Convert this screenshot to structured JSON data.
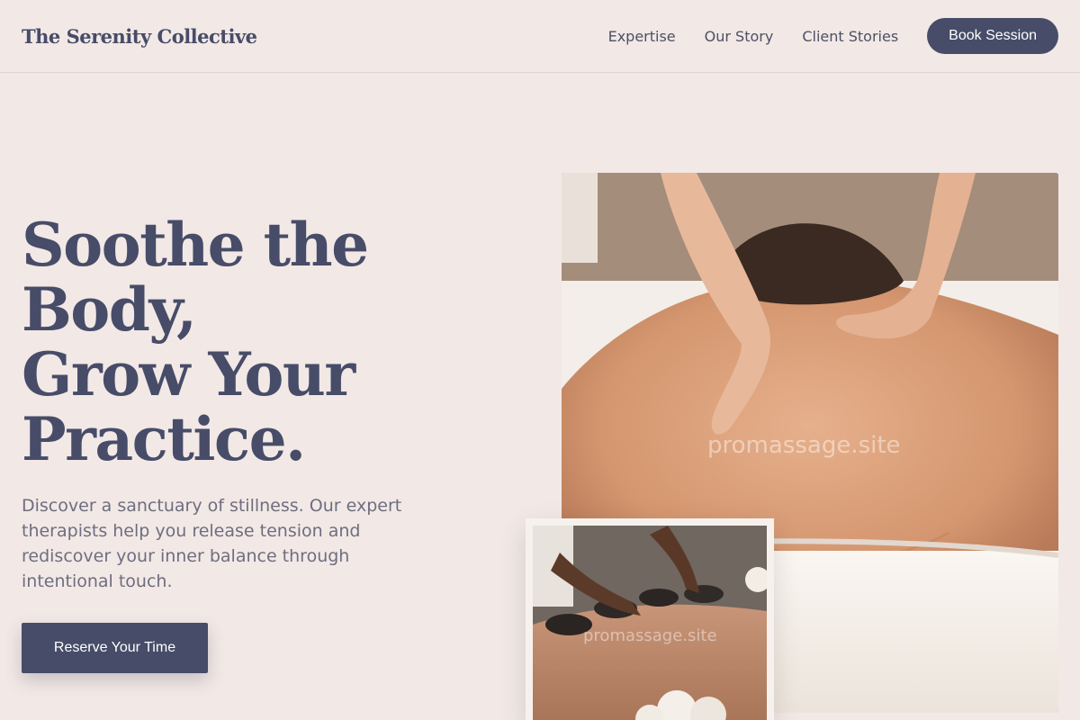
{
  "nav": {
    "brand": "The Serenity Collective",
    "links": [
      "Expertise",
      "Our Story",
      "Client Stories"
    ],
    "cta": "Book Session"
  },
  "hero": {
    "title_lines": [
      "Soothe the",
      "Body,",
      "Grow Your",
      "Practice."
    ],
    "subtitle": "Discover a sanctuary of stillness. Our expert therapists help you release tension and rediscover your inner balance through intentional touch.",
    "cta": "Reserve Your Time"
  },
  "images": {
    "main_watermark": "promassage.site",
    "inset_watermark": "promassage.site"
  },
  "colors": {
    "background": "#f2e8e5",
    "primary": "#474c68",
    "body_text": "#6e6e80"
  }
}
